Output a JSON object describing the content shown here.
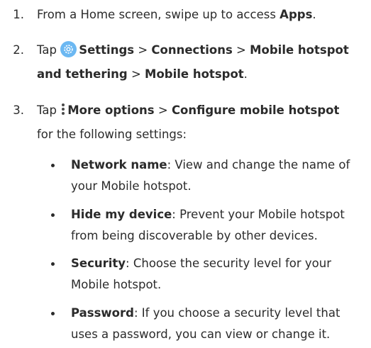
{
  "steps": [
    {
      "number": "1.",
      "prefix": "From a Home screen, swipe up to access ",
      "bold": "Apps",
      "suffix": "."
    },
    {
      "number": "2.",
      "tap": "Tap",
      "settings": "Settings",
      "sep1": " > ",
      "connections": "Connections",
      "sep2": " > ",
      "hotspot_tethering_line1": "Mobile hotspot",
      "hotspot_tethering_line2": "and tethering",
      "sep3": " > ",
      "mobile_hotspot": "Mobile hotspot",
      "suffix": "."
    },
    {
      "number": "3.",
      "tap": "Tap",
      "more_options": "More options",
      "sep": " > ",
      "configure": "Configure mobile hotspot",
      "line2": "for the following settings:"
    }
  ],
  "bullets": [
    {
      "term": "Network name",
      "line1": ": View and change the name of",
      "line2": "your Mobile hotspot."
    },
    {
      "term": "Hide my device",
      "line1": ": Prevent your Mobile hotspot",
      "line2": "from being discoverable by other devices."
    },
    {
      "term": "Security",
      "line1": ": Choose the security level for your",
      "line2": "Mobile hotspot."
    },
    {
      "term": "Password",
      "line1": ": If you choose a security level that",
      "line2": "uses a password, you can view or change it."
    }
  ],
  "icons": {
    "settings": "settings-gear-icon",
    "more_options": "more-options-vertical-dots-icon"
  },
  "colors": {
    "text": "#2b2b2b",
    "settings_icon_bg": "#6cb8f2"
  }
}
